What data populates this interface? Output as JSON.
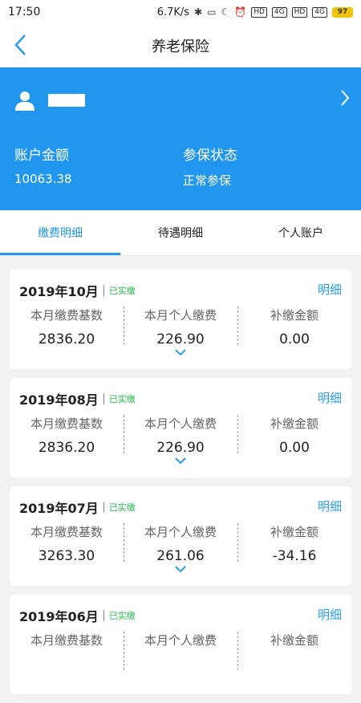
{
  "status": {
    "time": "17:50",
    "speed": "6.7K/s",
    "battery": "97",
    "net_a": "HD",
    "net_b": "4G",
    "net_c": "HD",
    "net_d": "4G"
  },
  "nav": {
    "title": "养老保险"
  },
  "account": {
    "balance_label": "账户金额",
    "balance_value": "10063.38",
    "status_label": "参保状态",
    "status_value": "正常参保"
  },
  "tabs": [
    {
      "label": "缴费明细"
    },
    {
      "label": "待遇明细"
    },
    {
      "label": "个人账户"
    }
  ],
  "columns": {
    "c1": "本月缴费基数",
    "c2": "本月个人缴费",
    "c3": "补缴金额"
  },
  "cards": [
    {
      "month": "2019年10月",
      "status": "已实缴",
      "detail": "明细",
      "base": "2836.20",
      "personal": "226.90",
      "supplement": "0.00"
    },
    {
      "month": "2019年08月",
      "status": "已实缴",
      "detail": "明细",
      "base": "2836.20",
      "personal": "226.90",
      "supplement": "0.00"
    },
    {
      "month": "2019年07月",
      "status": "已实缴",
      "detail": "明细",
      "base": "3263.30",
      "personal": "261.06",
      "supplement": "-34.16"
    },
    {
      "month": "2019年06月",
      "status": "已实缴",
      "detail": "明细",
      "base": "",
      "personal": "",
      "supplement": ""
    }
  ],
  "colors": {
    "primary": "#2196ee",
    "paid": "#2db84d",
    "background": "#f2f2f2"
  }
}
